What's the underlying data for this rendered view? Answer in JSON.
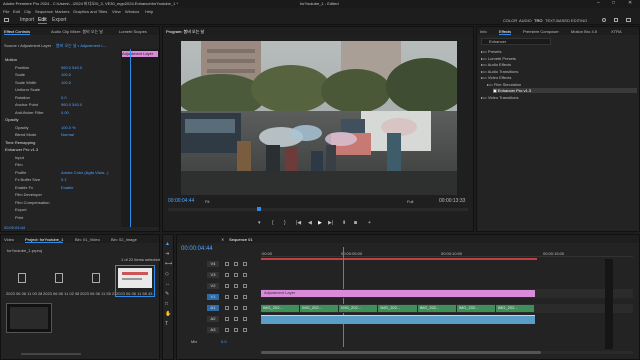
{
  "titlebar": {
    "app_title": "Adobe Premiere Pro 2024 - C:\\Users\\...\\2024 비디오\\0_3, VE30_mgo2024.Enhance\\forYoutube_1 *",
    "sequence_title": "forYoutube_1 - Edited"
  },
  "menu": [
    "File",
    "Edit",
    "Clip",
    "Sequence",
    "Markers",
    "Graphics and Titles",
    "View",
    "Window",
    "Help"
  ],
  "workspace_tabs": [
    "Import",
    "Edit",
    "Export"
  ],
  "header_right": [
    "COLOR",
    "AUDIO",
    "TRO",
    "TEXT-BASED EDITING"
  ],
  "effect_controls": {
    "tabs": [
      "Effect Controls",
      "Audio Clip Mixer: 봄비 오는 날",
      "Lumetri Scopes"
    ],
    "source": "Source • Adjustment Layer",
    "clip": "봄비 오는 날 • Adjustment L...",
    "timecode": "00:00:04:44",
    "sections": [
      {
        "label": "Motion"
      },
      {
        "label": "Position",
        "value": "960.0   540.0"
      },
      {
        "label": "Scale",
        "value": "100.0"
      },
      {
        "label": "Scale Width",
        "value": "100.0"
      },
      {
        "label": "Uniform Scale",
        "value": ""
      },
      {
        "label": "Rotation",
        "value": "0.0"
      },
      {
        "label": "Anchor Point",
        "value": "960.0   540.0"
      },
      {
        "label": "Anti-flicker Filter",
        "value": "0.00"
      },
      {
        "label": "Opacity"
      },
      {
        "label": "Opacity",
        "value": "100.0 %"
      },
      {
        "label": "Blend Mode",
        "value": "Normal"
      },
      {
        "label": "Time Remapping"
      },
      {
        "label": "Enhancer Pro v1.3"
      },
      {
        "label": "Input"
      },
      {
        "label": "Film"
      },
      {
        "label": "Profile",
        "value": "Adobe Color (Agfa Vista...)"
      },
      {
        "label": "Fx Buffer Size",
        "value": "0.1"
      },
      {
        "label": "Enable Fx",
        "value": "Enable"
      },
      {
        "label": "Film Developer"
      },
      {
        "label": "Film Compensation"
      },
      {
        "label": "Export"
      },
      {
        "label": "Print"
      }
    ],
    "mini_clip_label": "Adjustment Layer",
    "footer_time": "00:00:04:44"
  },
  "program": {
    "title": "Program: 봄비 오는 날",
    "timecode": "00:00:04:44",
    "fit": "Fit",
    "quality": "Full",
    "duration": "00:00:13:33"
  },
  "effects": {
    "tabs": [
      "Info",
      "Effects",
      "Premiere Composer",
      "Motion Bro 4.5",
      "XTRA"
    ],
    "search": "Enhancer",
    "tree": [
      {
        "label": "Presets"
      },
      {
        "label": "Lumetri Presets"
      },
      {
        "label": "Audio Effects"
      },
      {
        "label": "Audio Transitions"
      },
      {
        "label": "Video Effects"
      },
      {
        "label": "Film Simulation"
      },
      {
        "label": "Enhancer Pro v1.3"
      },
      {
        "label": "Video Transitions"
      }
    ]
  },
  "project": {
    "tabs": [
      "Video",
      "Project: forYoutube_1",
      "Bin: 01_Video",
      "Bin: 02_Image"
    ],
    "name": "forYoutube_1.prproj",
    "selection": "1 of 22 items selected",
    "items": [
      {
        "name": "2023 06 06 11 00 28..."
      },
      {
        "name": "2023 06 06 11 02 08..."
      },
      {
        "name": "2023 06 06 11 55 23..."
      },
      {
        "name": "2023 06 06 11 58 43..."
      }
    ]
  },
  "timeline": {
    "title": "Sequence 01",
    "timecode": "00:00:04:44",
    "ruler": [
      ":00:00",
      "00:00:05:00",
      "00:00:10:00",
      "00:00:15:00"
    ],
    "tracks_v": [
      "V4",
      "V3",
      "V2",
      "V1"
    ],
    "tracks_a": [
      "A1",
      "A2",
      "A3"
    ],
    "mix": "Mix",
    "mix_value": "0.0",
    "adj_clip": "Adjustment Layer",
    "v1_clips": [
      "IMG_202...",
      "IMG_202...",
      "IMG_202...",
      "IMG_202...",
      "IMG_202...",
      "IMG_202...",
      "IMG_202..."
    ]
  },
  "colors": {
    "accent": "#2d8ceb",
    "adjustment_clip": "#d98bd9",
    "video_clip": "#5a9ec8",
    "audio_clip": "#3f8f5a"
  }
}
